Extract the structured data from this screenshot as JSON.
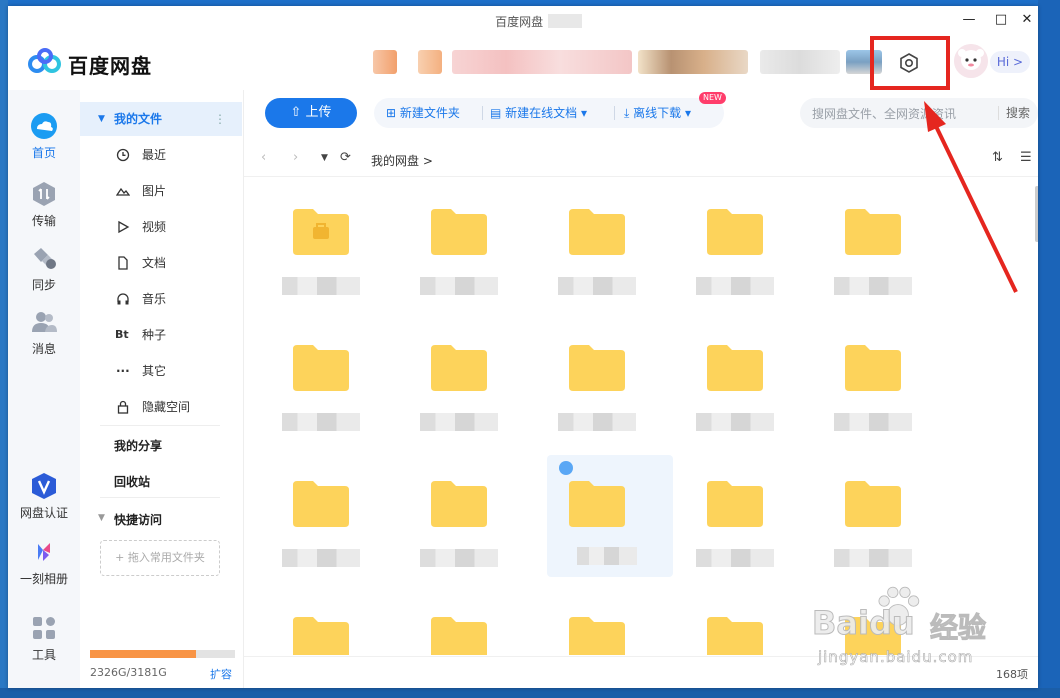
{
  "window": {
    "title": "百度网盘 ·",
    "controls": [
      "—",
      "□",
      "✕"
    ]
  },
  "header": {
    "logo_text": "百度网盘",
    "hi_label": "Hi >"
  },
  "rail": {
    "items": [
      {
        "label": "首页",
        "icon": "cloud-home-icon",
        "active": true
      },
      {
        "label": "传输",
        "icon": "transfer-icon"
      },
      {
        "label": "同步",
        "icon": "sync-icon"
      },
      {
        "label": "消息",
        "icon": "contacts-icon"
      },
      {
        "label": "网盘认证",
        "icon": "verify-v-icon"
      },
      {
        "label": "一刻相册",
        "icon": "album-icon"
      },
      {
        "label": "工具",
        "icon": "tools-grid-icon"
      }
    ]
  },
  "nav": {
    "my_files": "我的文件",
    "items": [
      {
        "label": "最近",
        "icon": "clock-icon"
      },
      {
        "label": "图片",
        "icon": "image-icon"
      },
      {
        "label": "视频",
        "icon": "play-icon"
      },
      {
        "label": "文档",
        "icon": "document-icon"
      },
      {
        "label": "音乐",
        "icon": "headphones-icon"
      },
      {
        "label": "种子",
        "icon": "bt-icon"
      },
      {
        "label": "其它",
        "icon": "more-dots-icon"
      },
      {
        "label": "隐藏空间",
        "icon": "lock-icon"
      }
    ],
    "my_share": "我的分享",
    "recycle": "回收站",
    "quick_access": "快捷访问",
    "drop_hint": "+ 拖入常用文件夹",
    "storage": {
      "used_text": "2326G/3181G",
      "used_fraction": 0.731,
      "expand": "扩容"
    }
  },
  "toolbar": {
    "upload": "上传",
    "new_folder": "新建文件夹",
    "new_online_doc": "新建在线文档",
    "new_badge": "NEW",
    "offline_download": "离线下载",
    "search_placeholder": "搜网盘文件、全网资源资讯",
    "search_button": "搜索"
  },
  "breadcrumb": {
    "root": "我的网盘",
    "sep": ">"
  },
  "files": {
    "count_label": "168项"
  },
  "watermark": {
    "main": "Baidu",
    "cn": "经验",
    "sub": "jingyan.baidu.com"
  },
  "colors": {
    "accent": "#1b78ea",
    "folder": "#fdd35b",
    "highlight": "#e5261f",
    "storage": "#f89445"
  }
}
